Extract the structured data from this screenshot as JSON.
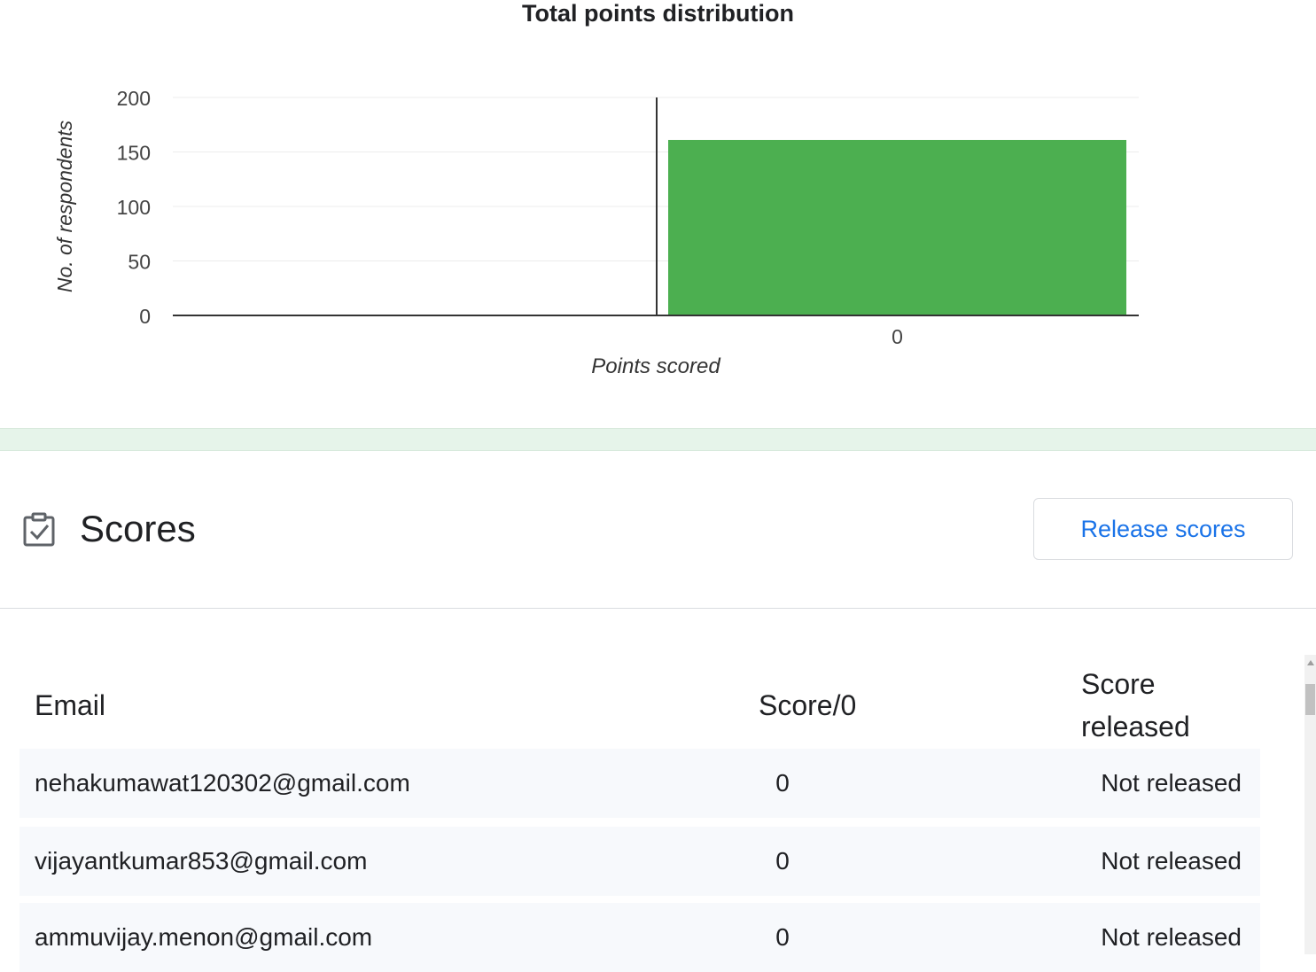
{
  "chart_data": {
    "type": "bar",
    "title": "Total points distribution",
    "xlabel": "Points scored",
    "ylabel": "No. of respondents",
    "categories": [
      "0"
    ],
    "values": [
      161
    ],
    "ylim": [
      0,
      200
    ],
    "yticks": [
      0,
      50,
      100,
      150,
      200
    ],
    "grid": true,
    "legend": "none",
    "bar_color": "#4caf50"
  },
  "scores": {
    "title": "Scores",
    "icon": "clipboard-check-icon",
    "release_button": "Release scores",
    "accent_color": "#1a73e8",
    "table": {
      "headers": {
        "email": "Email",
        "score": "Score/0",
        "released_line1": "Score",
        "released_line2": "released"
      },
      "rows": [
        {
          "email": "nehakumawat120302@gmail.com",
          "score": "0",
          "status": "Not released"
        },
        {
          "email": "vijayantkumar853@gmail.com",
          "score": "0",
          "status": "Not released"
        },
        {
          "email": "ammuvijay.menon@gmail.com",
          "score": "0",
          "status": "Not released"
        }
      ]
    }
  }
}
